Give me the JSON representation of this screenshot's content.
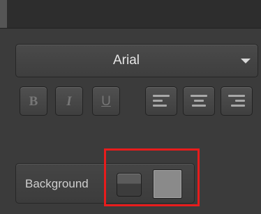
{
  "font": {
    "selected": "Arial",
    "arrow_icon": "chevron-down-icon"
  },
  "style_buttons": [
    {
      "glyph": "B",
      "icon": "bold-icon"
    },
    {
      "glyph": "I",
      "icon": "italic-icon"
    },
    {
      "glyph": "U",
      "icon": "underline-icon"
    }
  ],
  "align_buttons": [
    {
      "icon": "align-left-icon"
    },
    {
      "icon": "align-center-icon"
    },
    {
      "icon": "align-right-icon"
    }
  ],
  "background": {
    "label": "Background",
    "swatch_color": "#8a8a8a"
  },
  "colors": {
    "panel": "#3b3b3b",
    "highlight": "#e81c1c"
  }
}
